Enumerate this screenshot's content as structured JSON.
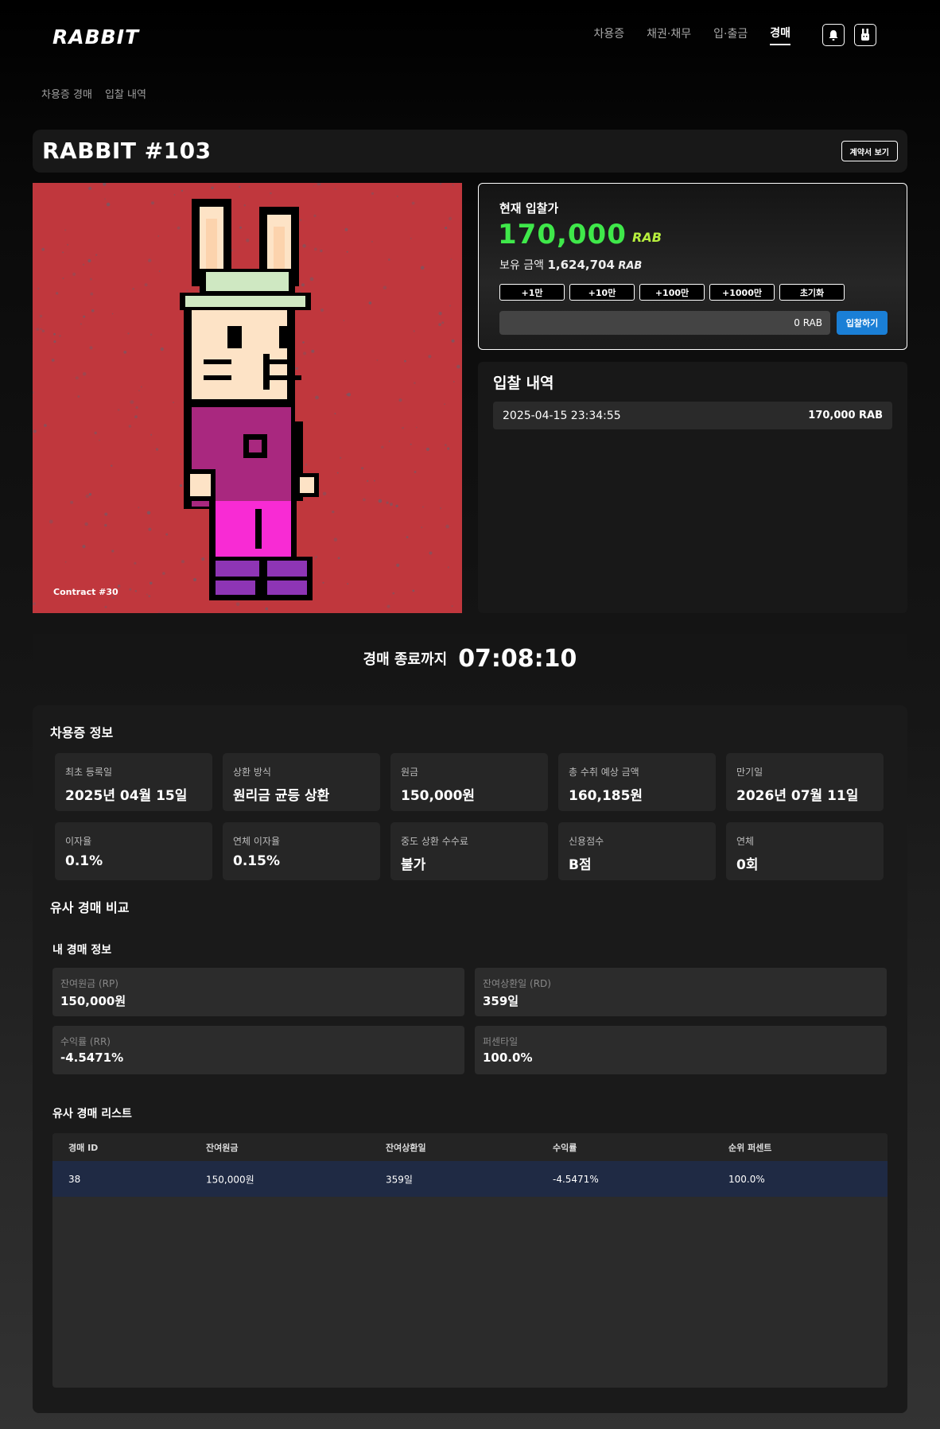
{
  "header": {
    "logo": "RABBIT",
    "nav": [
      "차용증",
      "채권·채무",
      "입·출금",
      "경매"
    ],
    "active_nav": "경매",
    "bell_icon": "bell-icon",
    "profile_icon": "rabbit-icon"
  },
  "breadcrumb": [
    "차용증 경매",
    "입찰 내역"
  ],
  "title": {
    "name": "RABBIT #103",
    "contract_button": "계약서 보기"
  },
  "nft": {
    "caption": "Contract #30",
    "background_color": "#c0373d"
  },
  "bid": {
    "label": "현재 입찰가",
    "value": "170,000",
    "unit": "RAB",
    "balance_label": "보유 금액",
    "balance_value": "1,624,704",
    "balance_unit": "RAB",
    "increments": [
      "+1만",
      "+10만",
      "+100만",
      "+1000만",
      "초기화"
    ],
    "input_value": "0 RAB",
    "submit_label": "입찰하기",
    "accent_color": "#3fe84a"
  },
  "history": {
    "title": "입찰 내역",
    "rows": [
      {
        "time": "2025-04-15 23:34:55",
        "amount": "170,000 RAB"
      }
    ]
  },
  "countdown": {
    "label": "경매 종료까지",
    "time": "07:08:10"
  },
  "info": {
    "title": "차용증 정보",
    "cards": [
      {
        "label": "최초 등록일",
        "value": "2025년 04월 15일"
      },
      {
        "label": "상환 방식",
        "value": "원리금 균등 상환"
      },
      {
        "label": "원금",
        "value": "150,000원"
      },
      {
        "label": "총 수취 예상 금액",
        "value": "160,185원"
      },
      {
        "label": "만기일",
        "value": "2026년 07월 11일"
      },
      {
        "label": "이자율",
        "value": "0.1%"
      },
      {
        "label": "연체 이자율",
        "value": "0.15%"
      },
      {
        "label": "중도 상환 수수료",
        "value": "불가"
      },
      {
        "label": "신용점수",
        "value": "B점"
      },
      {
        "label": "연체",
        "value": "0회"
      }
    ]
  },
  "compare": {
    "title": "유사 경매 비교",
    "my_title": "내 경매 정보",
    "my_cards": [
      {
        "label": "잔여원금 (RP)",
        "value": "150,000원"
      },
      {
        "label": "잔여상환일 (RD)",
        "value": "359일"
      },
      {
        "label": "수익률 (RR)",
        "value": "-4.5471%"
      },
      {
        "label": "퍼센타일",
        "value": "100.0%"
      }
    ],
    "list_title": "유사 경매 리스트",
    "columns": [
      "경매 ID",
      "잔여원금",
      "잔여상환일",
      "수익률",
      "순위 퍼센트"
    ],
    "rows": [
      [
        "38",
        "150,000원",
        "359일",
        "-4.5471%",
        "100.0%"
      ]
    ]
  }
}
